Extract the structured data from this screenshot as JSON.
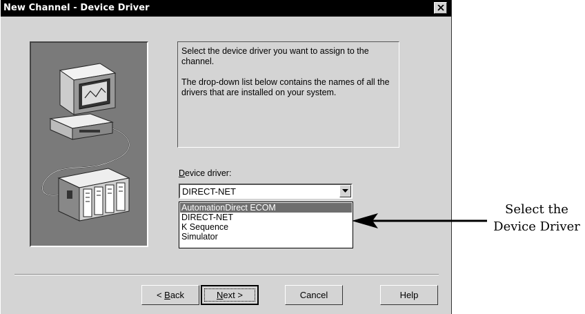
{
  "dialog": {
    "title": "New Channel - Device Driver",
    "close_label": "×"
  },
  "info": {
    "paragraph1": "Select the device driver you want to assign to the channel.",
    "paragraph2": "The drop-down list below contains the names of all the drivers that are installed on your system."
  },
  "device_driver": {
    "label_accel": "D",
    "label_rest": "evice driver:",
    "selected_value": "DIRECT-NET",
    "options": [
      "AutomationDirect ECOM",
      "DIRECT-NET",
      "K Sequence",
      "Simulator"
    ],
    "highlighted_option": "AutomationDirect ECOM"
  },
  "buttons": {
    "back_prefix": "< ",
    "back_accel": "B",
    "back_rest": "ack",
    "next_accel": "N",
    "next_rest": "ext >",
    "cancel": "Cancel",
    "help": "Help"
  },
  "annotation": {
    "line1": "Select the",
    "line2": "Device Driver"
  },
  "colors": {
    "dialog_bg": "#d4d4d4",
    "titlebar": "#000000",
    "highlight": "#6e6e6e",
    "art_bg": "#7a7a7a"
  },
  "icons": [
    "close-icon",
    "computer-illustration",
    "plc-rack-illustration",
    "dropdown-arrow-icon",
    "callout-arrow"
  ]
}
